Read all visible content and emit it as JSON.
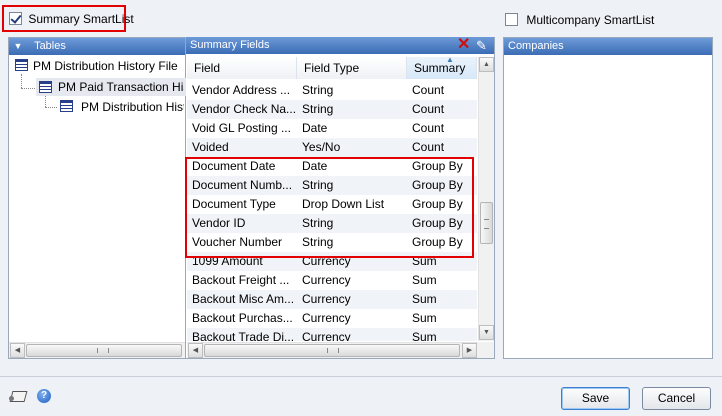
{
  "summary_checkbox": {
    "label": "Summary SmartList",
    "checked": true
  },
  "multicompany_checkbox": {
    "label": "Multicompany SmartList",
    "checked": false
  },
  "tables_panel": {
    "header": "Tables",
    "items": [
      {
        "label": "PM Distribution History File"
      },
      {
        "label": "PM Paid Transaction History"
      },
      {
        "label": "PM Distribution History"
      }
    ]
  },
  "summary_panel": {
    "header": "Summary Fields",
    "columns": [
      "Field",
      "Field Type",
      "Summary Ty"
    ],
    "rows": [
      {
        "field": "Vendor Address ...",
        "type": "String",
        "summary": "Count"
      },
      {
        "field": "Vendor Check Na...",
        "type": "String",
        "summary": "Count"
      },
      {
        "field": "Void GL Posting ...",
        "type": "Date",
        "summary": "Count"
      },
      {
        "field": "Voided",
        "type": "Yes/No",
        "summary": "Count"
      },
      {
        "field": "Document Date",
        "type": "Date",
        "summary": "Group By"
      },
      {
        "field": "Document Numb...",
        "type": "String",
        "summary": "Group By"
      },
      {
        "field": "Document Type",
        "type": "Drop Down List",
        "summary": "Group By"
      },
      {
        "field": "Vendor ID",
        "type": "String",
        "summary": "Group By"
      },
      {
        "field": "Voucher Number",
        "type": "String",
        "summary": "Group By"
      },
      {
        "field": "1099 Amount",
        "type": "Currency",
        "summary": "Sum"
      },
      {
        "field": "Backout Freight ...",
        "type": "Currency",
        "summary": "Sum"
      },
      {
        "field": "Backout Misc Am...",
        "type": "Currency",
        "summary": "Sum"
      },
      {
        "field": "Backout Purchas...",
        "type": "Currency",
        "summary": "Sum"
      },
      {
        "field": "Backout Trade Di...",
        "type": "Currency",
        "summary": "Sum"
      }
    ]
  },
  "companies_panel": {
    "header": "Companies"
  },
  "buttons": {
    "save": "Save",
    "cancel": "Cancel"
  },
  "colors": {
    "highlight": "#e30000",
    "header_blue": "#3b6cb4"
  }
}
